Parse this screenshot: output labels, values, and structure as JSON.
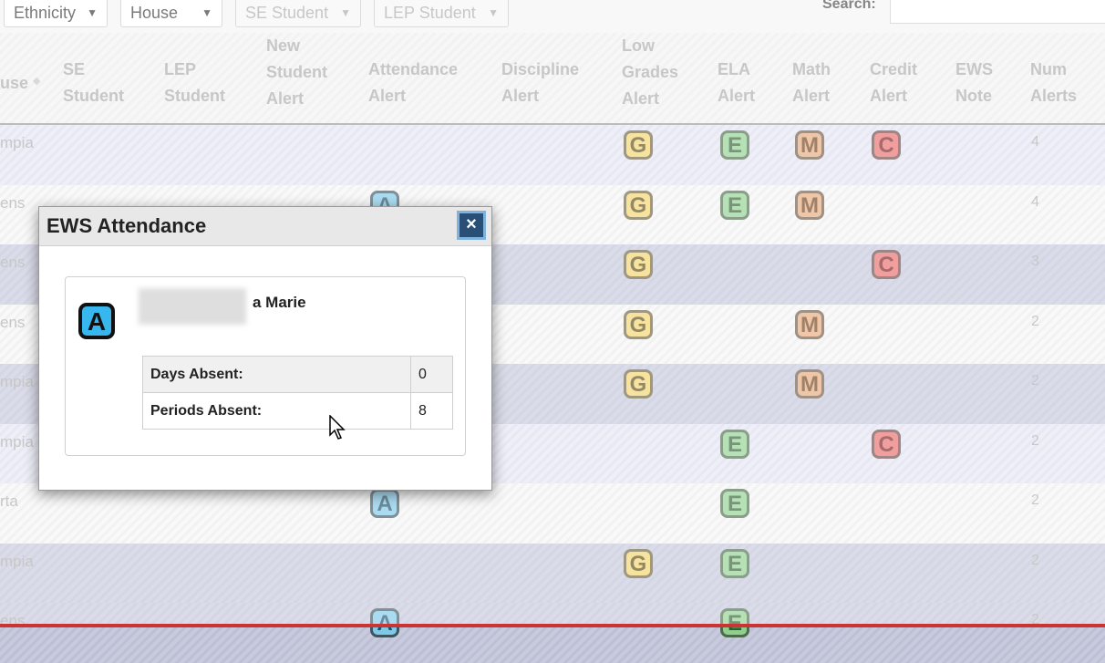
{
  "filters": [
    {
      "label": "Ethnicity",
      "disabled": false
    },
    {
      "label": "House",
      "disabled": false
    },
    {
      "label": "SE Student",
      "disabled": true
    },
    {
      "label": "LEP Student",
      "disabled": true
    }
  ],
  "search": {
    "label": "Search:",
    "value": ""
  },
  "table": {
    "headers": [
      {
        "line1": "use",
        "line2": "",
        "line3": ""
      },
      {
        "line1": "SE",
        "line2": "Student",
        "line3": ""
      },
      {
        "line1": "LEP",
        "line2": "Student",
        "line3": ""
      },
      {
        "line1": "New",
        "line2": "Student",
        "line3": "Alert"
      },
      {
        "line1": "Attendance",
        "line2": "Alert",
        "line3": ""
      },
      {
        "line1": "Discipline",
        "line2": "Alert",
        "line3": ""
      },
      {
        "line1": "Low",
        "line2": "Grades",
        "line3": "Alert"
      },
      {
        "line1": "ELA",
        "line2": "Alert",
        "line3": ""
      },
      {
        "line1": "Math",
        "line2": "Alert",
        "line3": ""
      },
      {
        "line1": "Credit",
        "line2": "Alert",
        "line3": ""
      },
      {
        "line1": "EWS",
        "line2": "Note",
        "line3": ""
      },
      {
        "line1": "Num",
        "line2": "Alerts",
        "line3": ""
      }
    ],
    "rows": [
      {
        "house": "mpia",
        "attendance": "",
        "grades": "G",
        "ela": "E",
        "math": "M",
        "credit": "C",
        "num": "4"
      },
      {
        "house": "ens",
        "attendance": "A",
        "grades": "G",
        "ela": "E",
        "math": "M",
        "credit": "",
        "num": "4"
      },
      {
        "house": "ens",
        "attendance": "",
        "grades": "G",
        "ela": "",
        "math": "",
        "credit": "C",
        "num": "3"
      },
      {
        "house": "ens",
        "attendance": "",
        "grades": "G",
        "ela": "",
        "math": "M",
        "credit": "",
        "num": "2"
      },
      {
        "house": "mpia",
        "attendance": "",
        "grades": "G",
        "ela": "",
        "math": "M",
        "credit": "",
        "num": "2"
      },
      {
        "house": "mpia",
        "attendance": "",
        "grades": "",
        "ela": "E",
        "math": "",
        "credit": "C",
        "num": "2"
      },
      {
        "house": "rta",
        "attendance": "A",
        "grades": "",
        "ela": "E",
        "math": "",
        "credit": "",
        "num": "2"
      },
      {
        "house": "mpia",
        "attendance": "",
        "grades": "G",
        "ela": "E",
        "math": "",
        "credit": "",
        "num": "2"
      },
      {
        "house": "ens",
        "attendance": "A",
        "grades": "",
        "ela": "E",
        "math": "",
        "credit": "",
        "num": "2"
      }
    ]
  },
  "modal": {
    "title": "EWS Attendance",
    "close_label": "×",
    "icon_letter": "A",
    "student_name_visible": "a Marie",
    "stats": [
      {
        "label": "Days Absent:",
        "value": "0"
      },
      {
        "label": "Periods Absent:",
        "value": "8"
      }
    ]
  },
  "colors": {
    "grades_badge": "#f3d46a",
    "ela_badge": "#8fd08f",
    "math_badge": "#e7a878",
    "credit_badge": "#e86a6a",
    "attendance_badge": "#7ec8e8",
    "close_button": "#2a4f77"
  }
}
